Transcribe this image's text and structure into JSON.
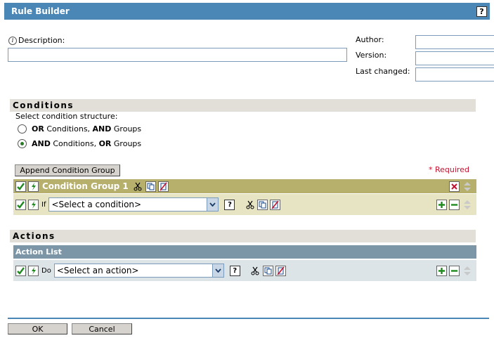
{
  "window": {
    "title": "Rule Builder",
    "help": "?"
  },
  "description": {
    "label": "Description:",
    "value": ""
  },
  "meta": {
    "author_label": "Author:",
    "version_label": "Version:",
    "last_changed_label": "Last changed:"
  },
  "conditions": {
    "header": "Conditions",
    "structure_label": "Select condition structure:",
    "options": [
      {
        "pre": "OR",
        "mid": " Conditions, ",
        "bold2": "AND",
        "post": " Groups",
        "selected": false
      },
      {
        "pre": "AND",
        "mid": " Conditions, ",
        "bold2": "OR",
        "post": " Groups",
        "selected": true
      }
    ],
    "append_label": "Append Condition Group",
    "required_text": "* Required",
    "group_title": "Condition Group 1",
    "if_label": "If",
    "select_value": "<Select a condition>",
    "help": "?"
  },
  "actions": {
    "header": "Actions",
    "list_title": "Action List",
    "do_label": "Do",
    "select_value": "<Select an action>",
    "help": "?"
  },
  "footer": {
    "ok": "OK",
    "cancel": "Cancel"
  },
  "colors": {
    "titlebar": "#4a87b6",
    "group_header": "#b6b06c",
    "group_row": "#e7e4c3",
    "action_header": "#7c96a8",
    "action_row": "#dde4e8",
    "required": "#c8102e"
  }
}
